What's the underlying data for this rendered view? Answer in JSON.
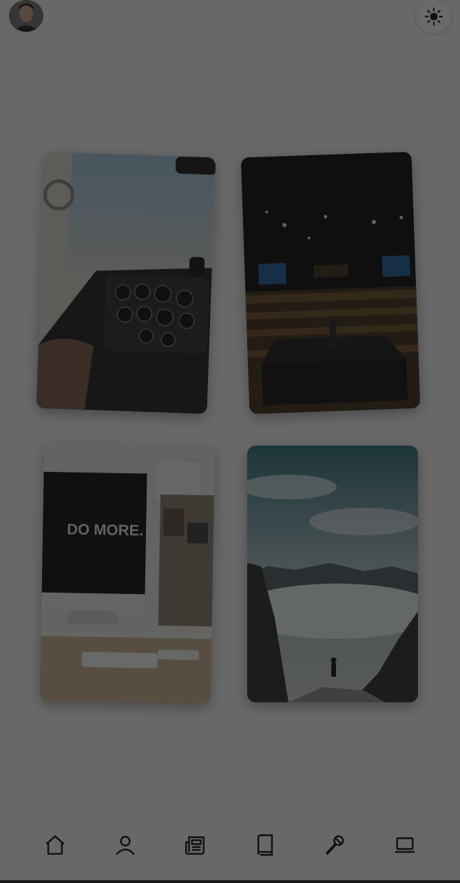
{
  "header": {
    "avatar_icon": "user-avatar",
    "theme_icon": "sun-icon"
  },
  "gallery": {
    "photos": [
      {
        "subject": "cockpit"
      },
      {
        "subject": "conference-stage"
      },
      {
        "subject": "desk-computer"
      },
      {
        "subject": "mountain-clouds"
      }
    ],
    "screen_text": "DO MORE."
  },
  "nav": {
    "items": [
      {
        "icon": "home-icon"
      },
      {
        "icon": "user-icon"
      },
      {
        "icon": "newspaper-icon"
      },
      {
        "icon": "book-icon"
      },
      {
        "icon": "microphone-icon"
      },
      {
        "icon": "laptop-icon"
      }
    ]
  },
  "colors": {
    "overlay": "#141414",
    "background": "#f2f2f2",
    "icon_stroke": "#111111"
  }
}
